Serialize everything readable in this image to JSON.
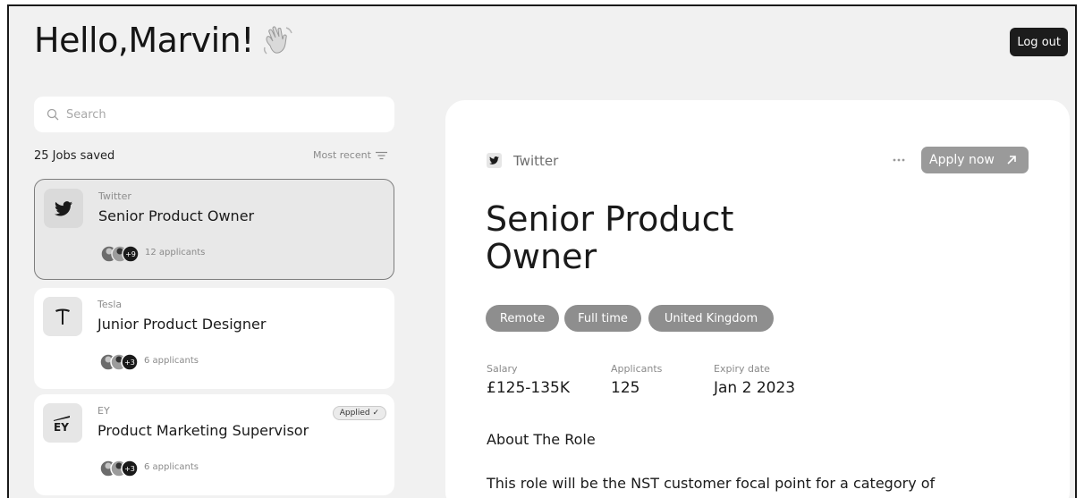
{
  "header": {
    "greeting": "Hello,Marvin!",
    "logout_label": "Log out"
  },
  "search": {
    "placeholder": "Search"
  },
  "list": {
    "saved_count": "25 Jobs saved",
    "sort_label": "Most recent",
    "jobs": [
      {
        "company": "Twitter",
        "title": "Senior Product Owner",
        "applicants": "12 applicants",
        "extra_avatars": "+9",
        "selected": true
      },
      {
        "company": "Tesla",
        "title": "Junior Product Designer",
        "applicants": "6 applicants",
        "extra_avatars": "+3",
        "selected": false
      },
      {
        "company": "EY",
        "title": "Product Marketing Supervisor",
        "applicants": "6 applicants",
        "extra_avatars": "+3",
        "selected": false,
        "badge": "Applied ✓"
      }
    ]
  },
  "detail": {
    "company": "Twitter",
    "apply_label": "Apply now",
    "title": "Senior Product Owner",
    "tags": [
      "Remote",
      "Full time",
      "United Kingdom"
    ],
    "meta": [
      {
        "label": "Salary",
        "value": "£125-135K"
      },
      {
        "label": "Applicants",
        "value": "125"
      },
      {
        "label": "Expiry date",
        "value": "Jan 2 2023"
      }
    ],
    "about_heading": "About The Role",
    "description": "This role will be the NST customer focal point for a category of projects with the various upstream teams in multiple"
  },
  "icons": {
    "wave": "waving-hand-icon",
    "search": "search-icon",
    "sort": "sort-icon",
    "twitter": "twitter-logo-icon",
    "tesla": "tesla-logo-icon",
    "ey": "ey-logo-icon",
    "more": "more-dots-icon",
    "arrow": "arrow-up-right-icon"
  }
}
